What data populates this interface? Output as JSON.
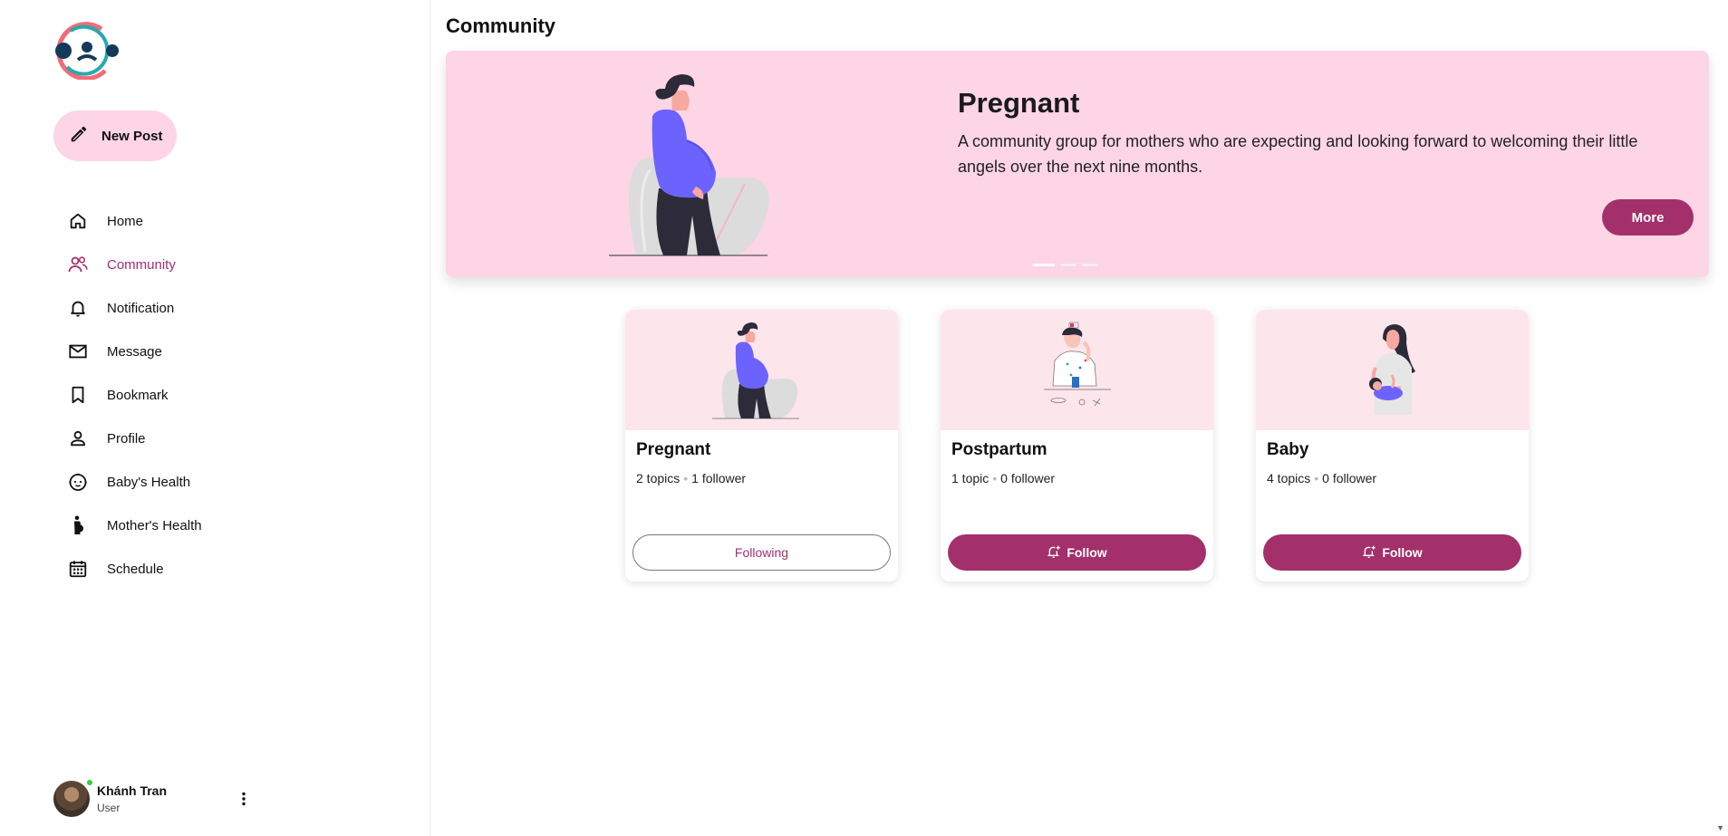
{
  "sidebar": {
    "new_post_label": "New Post",
    "items": [
      {
        "label": "Home",
        "icon": "home-icon",
        "active": false
      },
      {
        "label": "Community",
        "icon": "community-icon",
        "active": true
      },
      {
        "label": "Notification",
        "icon": "bell-icon",
        "active": false
      },
      {
        "label": "Message",
        "icon": "mail-icon",
        "active": false
      },
      {
        "label": "Bookmark",
        "icon": "bookmark-icon",
        "active": false
      },
      {
        "label": "Profile",
        "icon": "person-icon",
        "active": false
      },
      {
        "label": "Baby's Health",
        "icon": "baby-icon",
        "active": false
      },
      {
        "label": "Mother's Health",
        "icon": "pregnant-icon",
        "active": false
      },
      {
        "label": "Schedule",
        "icon": "calendar-icon",
        "active": false
      }
    ],
    "user": {
      "name": "Khánh Tran",
      "role": "User"
    }
  },
  "main": {
    "title": "Community",
    "banner": {
      "title": "Pregnant",
      "description": "A community group for mothers who are expecting and looking forward to welcoming their little angels over the next nine months.",
      "more_label": "More",
      "slides": 3,
      "active_slide": 1
    },
    "cards": [
      {
        "title": "Pregnant",
        "topics": "2 topics",
        "followers": "1 follower",
        "button": "Following",
        "following": true
      },
      {
        "title": "Postpartum",
        "topics": "1 topic",
        "followers": "0 follower",
        "button": "Follow",
        "following": false
      },
      {
        "title": "Baby",
        "topics": "4 topics",
        "followers": "0 follower",
        "button": "Follow",
        "following": false
      }
    ]
  },
  "colors": {
    "accent": "#a3306b",
    "banner_bg": "#fdd5e4",
    "card_img_bg": "#fde5ec",
    "online": "#3ec83b"
  }
}
